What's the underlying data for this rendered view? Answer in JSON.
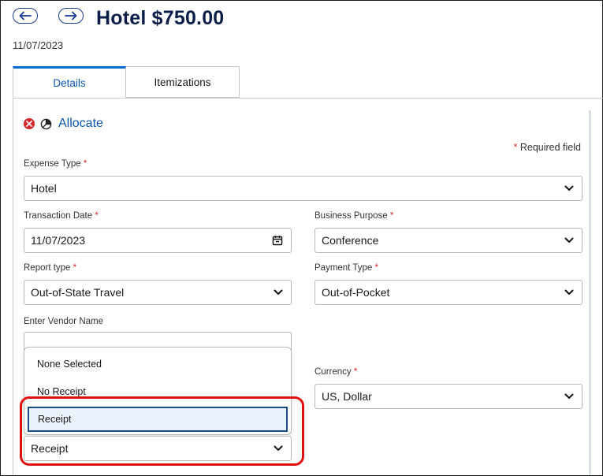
{
  "header": {
    "back_icon": "arrow-left-icon",
    "forward_icon": "arrow-right-icon",
    "title": "Hotel $750.00",
    "date": "11/07/2023"
  },
  "tabs": [
    {
      "label": "Details",
      "active": true
    },
    {
      "label": "Itemizations",
      "active": false
    }
  ],
  "allocate": {
    "remove_icon": "error-x-icon",
    "pie_icon": "allocate-pie-icon",
    "label": "Allocate"
  },
  "required_note": {
    "star": "*",
    "text": "Required field"
  },
  "form": {
    "expense_type": {
      "label": "Expense Type",
      "required": "*",
      "value": "Hotel"
    },
    "transaction_date": {
      "label": "Transaction Date",
      "required": "*",
      "value": "11/07/2023"
    },
    "business_purpose": {
      "label": "Business Purpose",
      "required": "*",
      "value": "Conference"
    },
    "report_type": {
      "label": "Report type",
      "required": "*",
      "value": "Out-of-State Travel"
    },
    "payment_type": {
      "label": "Payment Type",
      "required": "*",
      "value": "Out-of-Pocket"
    },
    "vendor_name": {
      "label": "Enter Vendor Name",
      "value": ""
    },
    "currency": {
      "label": "Currency",
      "required": "*",
      "value": "US, Dollar"
    },
    "receipt": {
      "value": "Receipt"
    }
  },
  "receipt_dropdown": {
    "options": [
      "None Selected",
      "No Receipt",
      "Receipt"
    ],
    "selected": "Receipt"
  },
  "colors": {
    "accent": "#0a6ed1",
    "title": "#0b1e4a",
    "required": "#d6282b",
    "highlight": "#e01010"
  }
}
